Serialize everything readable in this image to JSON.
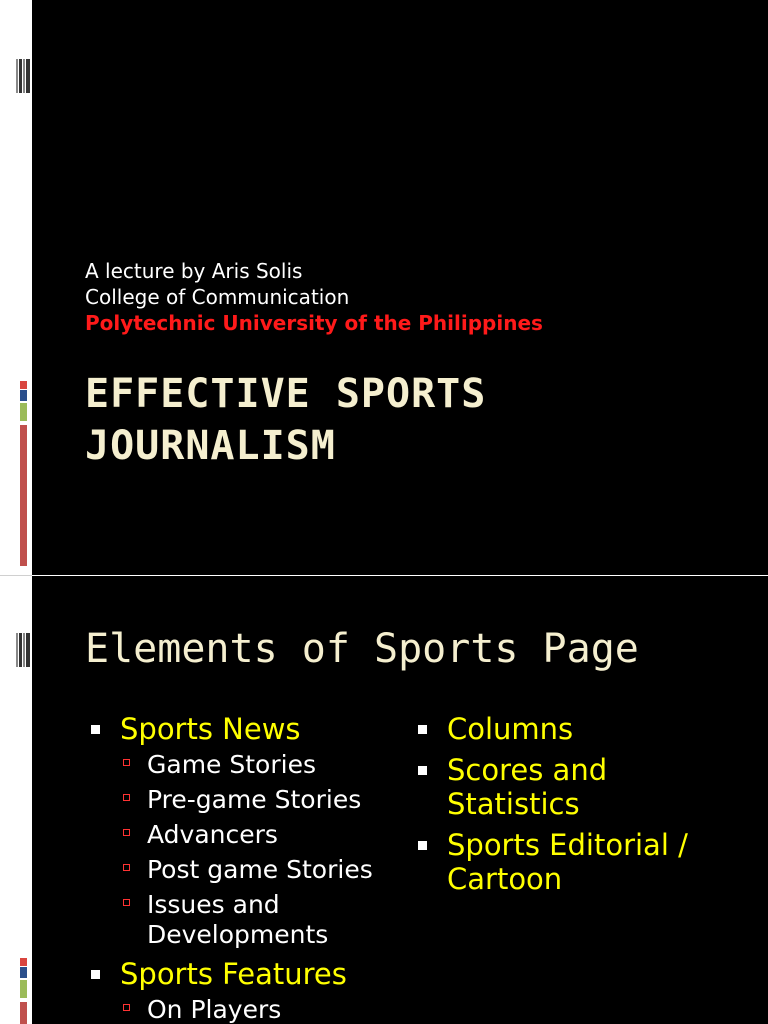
{
  "slides": [
    {
      "subtitle_lines": [
        "A lecture by Aris Solis",
        "College of Communication",
        "Polytechnic University of the Philippines"
      ],
      "title": "EFFECTIVE SPORTS JOURNALISM"
    },
    {
      "title": "Elements of Sports Page",
      "left_column": [
        {
          "label": "Sports News",
          "children": [
            "Game Stories",
            "Pre-game Stories",
            "Advancers",
            "Post game Stories",
            "Issues and Developments"
          ]
        },
        {
          "label": "Sports Features",
          "children": [
            "On Players"
          ]
        }
      ],
      "right_column": [
        {
          "label": "Columns",
          "children": []
        },
        {
          "label": "Scores and Statistics",
          "children": []
        },
        {
          "label": "Sports Editorial / Cartoon",
          "children": []
        }
      ]
    }
  ],
  "colors": {
    "slide_bg": "#000000",
    "title": "#f5efcf",
    "level1_text": "#ffff00",
    "level2_text": "#ffffff",
    "subtitle_accent": "#ff1a1a",
    "sub_bullet": "#ff3333"
  },
  "icons": {
    "slide_thumbnail": "slide-thumbnail-icon",
    "level1_bullet": "square-bullet-icon",
    "level2_bullet": "hollow-square-bullet-icon"
  }
}
